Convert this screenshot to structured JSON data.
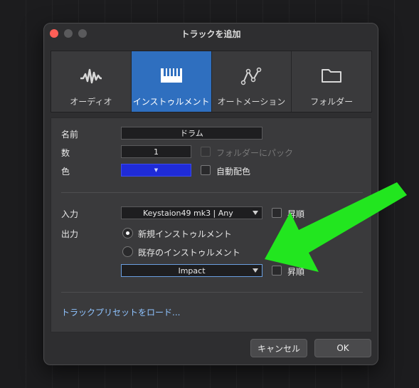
{
  "dialog": {
    "title": "トラックを追加"
  },
  "tabs": [
    {
      "label": "オーディオ",
      "icon": "waveform-icon"
    },
    {
      "label": "インストゥルメント",
      "icon": "keyboard-icon"
    },
    {
      "label": "オートメーション",
      "icon": "automation-icon"
    },
    {
      "label": "フォルダー",
      "icon": "folder-icon"
    }
  ],
  "form": {
    "name_label": "名前",
    "name_value": "ドラム",
    "count_label": "数",
    "count_value": "1",
    "folder_pack_label": "フォルダーにパック",
    "color_label": "色",
    "color_value": "#1f2bd8",
    "auto_color_label": "自動配色",
    "input_label": "入力",
    "input_value": "Keystaion49 mk3 | Any",
    "input_ascending_label": "昇順",
    "output_label": "出力",
    "new_instrument_label": "新規インストゥルメント",
    "existing_instrument_label": "既存のインストゥルメント",
    "instrument_value": "Impact",
    "instrument_ascending_label": "昇順",
    "preset_link": "トラックプリセットをロード..."
  },
  "footer": {
    "cancel_label": "キャンセル",
    "ok_label": "OK"
  },
  "colors": {
    "accent_tab": "#2f6fbf",
    "annotation_arrow": "#22e61f"
  }
}
